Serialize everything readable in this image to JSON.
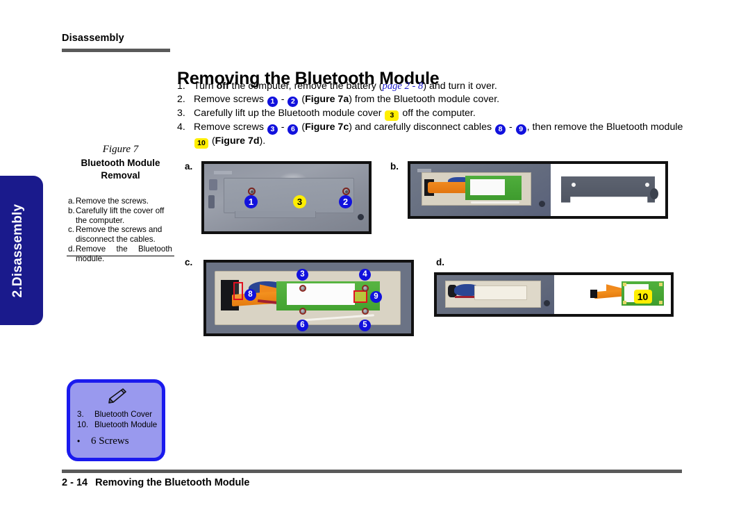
{
  "chapter_tab": {
    "label": "2.Disassembly",
    "bg_color": "#1a1a8c",
    "text_color": "#ffffff"
  },
  "running_head": {
    "label": "Disassembly"
  },
  "page_title": {
    "text": "Removing the Bluetooth Module"
  },
  "steps": [
    {
      "number": "1.",
      "segments": [
        {
          "type": "text",
          "value": "Turn "
        },
        {
          "type": "bold",
          "value": "off"
        },
        {
          "type": "text",
          "value": " the computer, remove the battery ("
        },
        {
          "type": "xref",
          "value": "page 2 - 8"
        },
        {
          "type": "text",
          "value": ") and turn it over."
        }
      ]
    },
    {
      "number": "2.",
      "segments": [
        {
          "type": "text",
          "value": "Remove screws "
        },
        {
          "type": "badge-blue",
          "value": "1"
        },
        {
          "type": "text",
          "value": " - "
        },
        {
          "type": "badge-blue",
          "value": "2"
        },
        {
          "type": "text",
          "value": " ("
        },
        {
          "type": "bold",
          "value": "Figure 7a"
        },
        {
          "type": "text",
          "value": ") from the Bluetooth module cover."
        }
      ]
    },
    {
      "number": "3.",
      "segments": [
        {
          "type": "text",
          "value": "Carefully lift up the Bluetooth module cover "
        },
        {
          "type": "badge-yellow",
          "value": "3"
        },
        {
          "type": "text",
          "value": " off the computer."
        }
      ]
    },
    {
      "number": "4.",
      "segments": [
        {
          "type": "text",
          "value": "Remove screws "
        },
        {
          "type": "badge-blue",
          "value": "3"
        },
        {
          "type": "text",
          "value": " - "
        },
        {
          "type": "badge-blue",
          "value": "6"
        },
        {
          "type": "text",
          "value": " ("
        },
        {
          "type": "bold",
          "value": "Figure 7c"
        },
        {
          "type": "text",
          "value": ") and carefully disconnect cables "
        },
        {
          "type": "badge-blue",
          "value": "8"
        },
        {
          "type": "text",
          "value": " - "
        },
        {
          "type": "badge-blue",
          "value": "9"
        },
        {
          "type": "text",
          "value": ", then remove the Bluetooth module "
        },
        {
          "type": "badge-yellow",
          "value": "10"
        },
        {
          "type": "text",
          "value": " ("
        },
        {
          "type": "bold",
          "value": "Figure 7d"
        },
        {
          "type": "text",
          "value": ")."
        }
      ]
    }
  ],
  "figure_caption": {
    "figure_number": "Figure 7",
    "title_line1": "Bluetooth Module",
    "title_line2": "Removal",
    "legend": [
      {
        "key": "a.",
        "text": "Remove the screws."
      },
      {
        "key": "b.",
        "text": "Carefully lift the cover off the computer."
      },
      {
        "key": "c.",
        "text": "Remove the screws and disconnect the cables."
      },
      {
        "key": "d.",
        "text": "Remove the Bluetooth module."
      }
    ]
  },
  "note_box": {
    "icon": "pen-icon",
    "border_color": "#1a1aee",
    "fill_color": "#9999ee",
    "items": [
      {
        "key": "3.",
        "label": "Bluetooth Cover"
      },
      {
        "key": "10.",
        "label": "Bluetooth Module"
      }
    ],
    "bullet": {
      "marker": "•",
      "label": "6 Screws"
    }
  },
  "panels": [
    {
      "letter": "a.",
      "name": "laptop-base-with-cover",
      "callouts": [
        {
          "value": "1",
          "style": "blue"
        },
        {
          "value": "3",
          "style": "yellow"
        },
        {
          "value": "2",
          "style": "blue"
        }
      ]
    },
    {
      "letter": "b.",
      "name": "cover-removed-and-cover-plate",
      "callouts": []
    },
    {
      "letter": "c.",
      "name": "module-screws-and-cables",
      "callouts": [
        {
          "value": "3",
          "style": "blue"
        },
        {
          "value": "4",
          "style": "blue"
        },
        {
          "value": "8",
          "style": "blue"
        },
        {
          "value": "9",
          "style": "blue"
        },
        {
          "value": "6",
          "style": "blue"
        },
        {
          "value": "5",
          "style": "blue"
        }
      ]
    },
    {
      "letter": "d.",
      "name": "module-removed",
      "callouts": [
        {
          "value": "10",
          "style": "yellow-rect"
        }
      ]
    }
  ],
  "footer": {
    "page_number": "2 - 14",
    "title": "Removing the Bluetooth Module"
  }
}
